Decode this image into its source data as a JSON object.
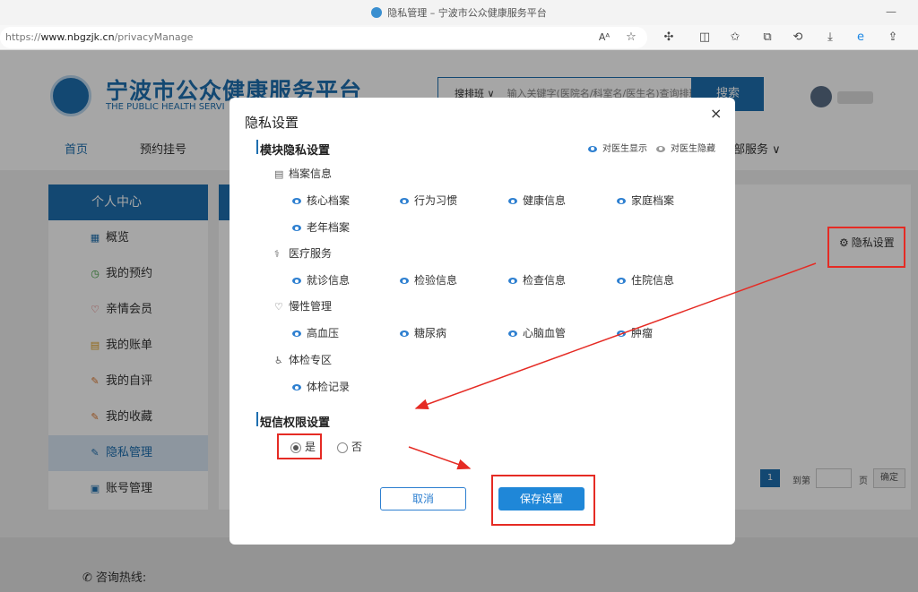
{
  "browser": {
    "title": "隐私管理 – 宁波市公众健康服务平台",
    "url_scheme": "https://",
    "url_host": "www.nbgzjk.cn",
    "url_path": "/privacyManage",
    "reader_label": "Aᴬ"
  },
  "site": {
    "name": "宁波市公众健康服务平台",
    "subtitle": "THE PUBLIC HEALTH SERVI",
    "search_category": "搜排班 ∨",
    "search_placeholder": "输入关键字(医院名/科室名/医生名)查询排班",
    "search_button": "搜索",
    "nav": [
      "首页",
      "预约挂号",
      "部服务 ∨"
    ]
  },
  "sidebar": {
    "header": "个人中心",
    "items": [
      {
        "label": "概览",
        "icon": "grid-icon"
      },
      {
        "label": "我的预约",
        "icon": "clock-icon"
      },
      {
        "label": "亲情会员",
        "icon": "heart-icon"
      },
      {
        "label": "我的账单",
        "icon": "bill-icon"
      },
      {
        "label": "我的自评",
        "icon": "edit-icon"
      },
      {
        "label": "我的收藏",
        "icon": "star-doc-icon"
      },
      {
        "label": "隐私管理",
        "icon": "privacy-icon",
        "active": true
      },
      {
        "label": "账号管理",
        "icon": "account-icon"
      }
    ]
  },
  "main": {
    "privacy_settings_link": "隐私设置",
    "pagination": {
      "current": "1",
      "goto_label": "到第",
      "page_label": "页",
      "confirm": "确定"
    }
  },
  "footer": {
    "hotline": "咨询热线:"
  },
  "modal": {
    "title": "隐私设置",
    "close": "×",
    "module_section": "模块隐私设置",
    "legend_visible": "对医生显示",
    "legend_hidden": "对医生隐藏",
    "groups": [
      {
        "label": "档案信息",
        "options": [
          "核心档案",
          "行为习惯",
          "健康信息",
          "家庭档案",
          "老年档案"
        ]
      },
      {
        "label": "医疗服务",
        "options": [
          "就诊信息",
          "检验信息",
          "检查信息",
          "住院信息"
        ]
      },
      {
        "label": "慢性管理",
        "options": [
          "高血压",
          "糖尿病",
          "心脑血管",
          "肿瘤"
        ]
      },
      {
        "label": "体检专区",
        "options": [
          "体检记录"
        ]
      }
    ],
    "sms_section": "短信权限设置",
    "sms_yes": "是",
    "sms_no": "否",
    "sms_selected": "是",
    "cancel_button": "取消",
    "save_button": "保存设置"
  },
  "annotation_color": "#e52b24"
}
